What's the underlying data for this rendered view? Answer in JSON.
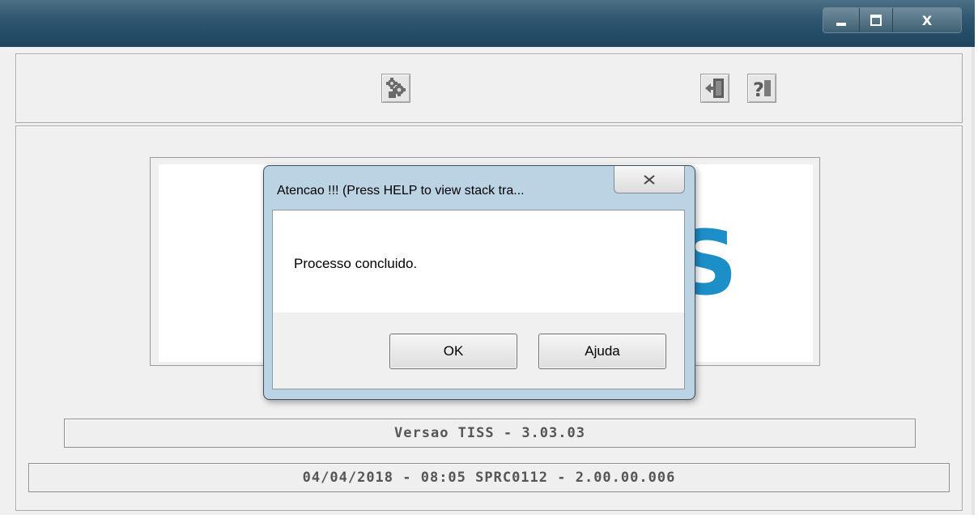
{
  "window": {
    "buttons": {
      "minimize": "",
      "maximize": "",
      "close": "X"
    }
  },
  "toolbar": {
    "icons": [
      "puzzle-gears-icon",
      "exit-door-icon",
      "help-question-icon"
    ]
  },
  "logo": {
    "partial_letter": "S",
    "color": "#1c8ec8"
  },
  "fields": {
    "version": "Versao TISS - 3.03.03",
    "info": "04/04/2018 - 08:05   SPRC0112  - 2.00.00.006"
  },
  "dialog": {
    "title": "Atencao !!! (Press HELP to view stack tra...",
    "message": "Processo concluido.",
    "ok_label": "OK",
    "help_label": "Ajuda"
  }
}
